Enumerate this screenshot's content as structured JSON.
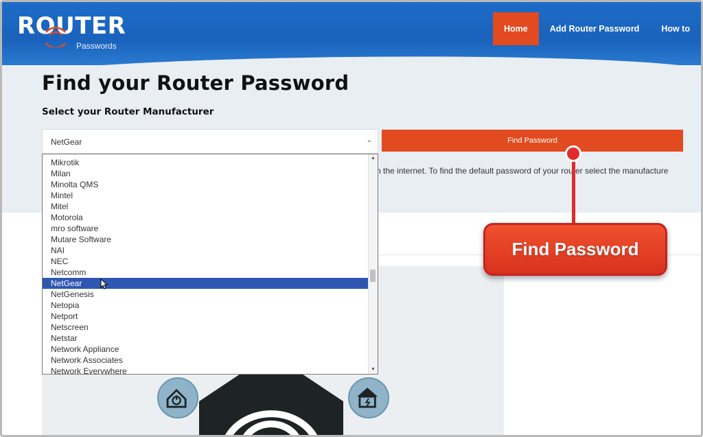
{
  "header": {
    "logo_main": "ROUTER",
    "logo_sub": "Passwords",
    "nav": [
      {
        "label": "Home",
        "active": true
      },
      {
        "label": "Add Router Password",
        "active": false
      },
      {
        "label": "How to",
        "active": false
      }
    ],
    "colors": {
      "brand_blue": "#1a62bb",
      "accent_orange": "#e24a1f"
    }
  },
  "main": {
    "title": "Find your Router Password",
    "subtitle": "Select your Router Manufacturer",
    "select_value": "NetGear",
    "find_button_label": "Find Password",
    "description_fragment": "n the internet. To find the default password of your router select the manufacture"
  },
  "dropdown": {
    "items": [
      "Mikrotik",
      "Milan",
      "Minolta QMS",
      "Mintel",
      "Mitel",
      "Motorola",
      "mro software",
      "Mutare Software",
      "NAI",
      "NEC",
      "Netcomm",
      "NetGear",
      "NetGenesis",
      "Netopia",
      "Netport",
      "Netscreen",
      "Netstar",
      "Network Appliance",
      "Network Associates",
      "Network Everywhere"
    ],
    "selected": "NetGear"
  },
  "icons": [
    "power-home-icon",
    "solar-home-icon",
    "wifi-house-icon"
  ],
  "callout": {
    "label": "Find Password",
    "color": "#e22b2b"
  }
}
